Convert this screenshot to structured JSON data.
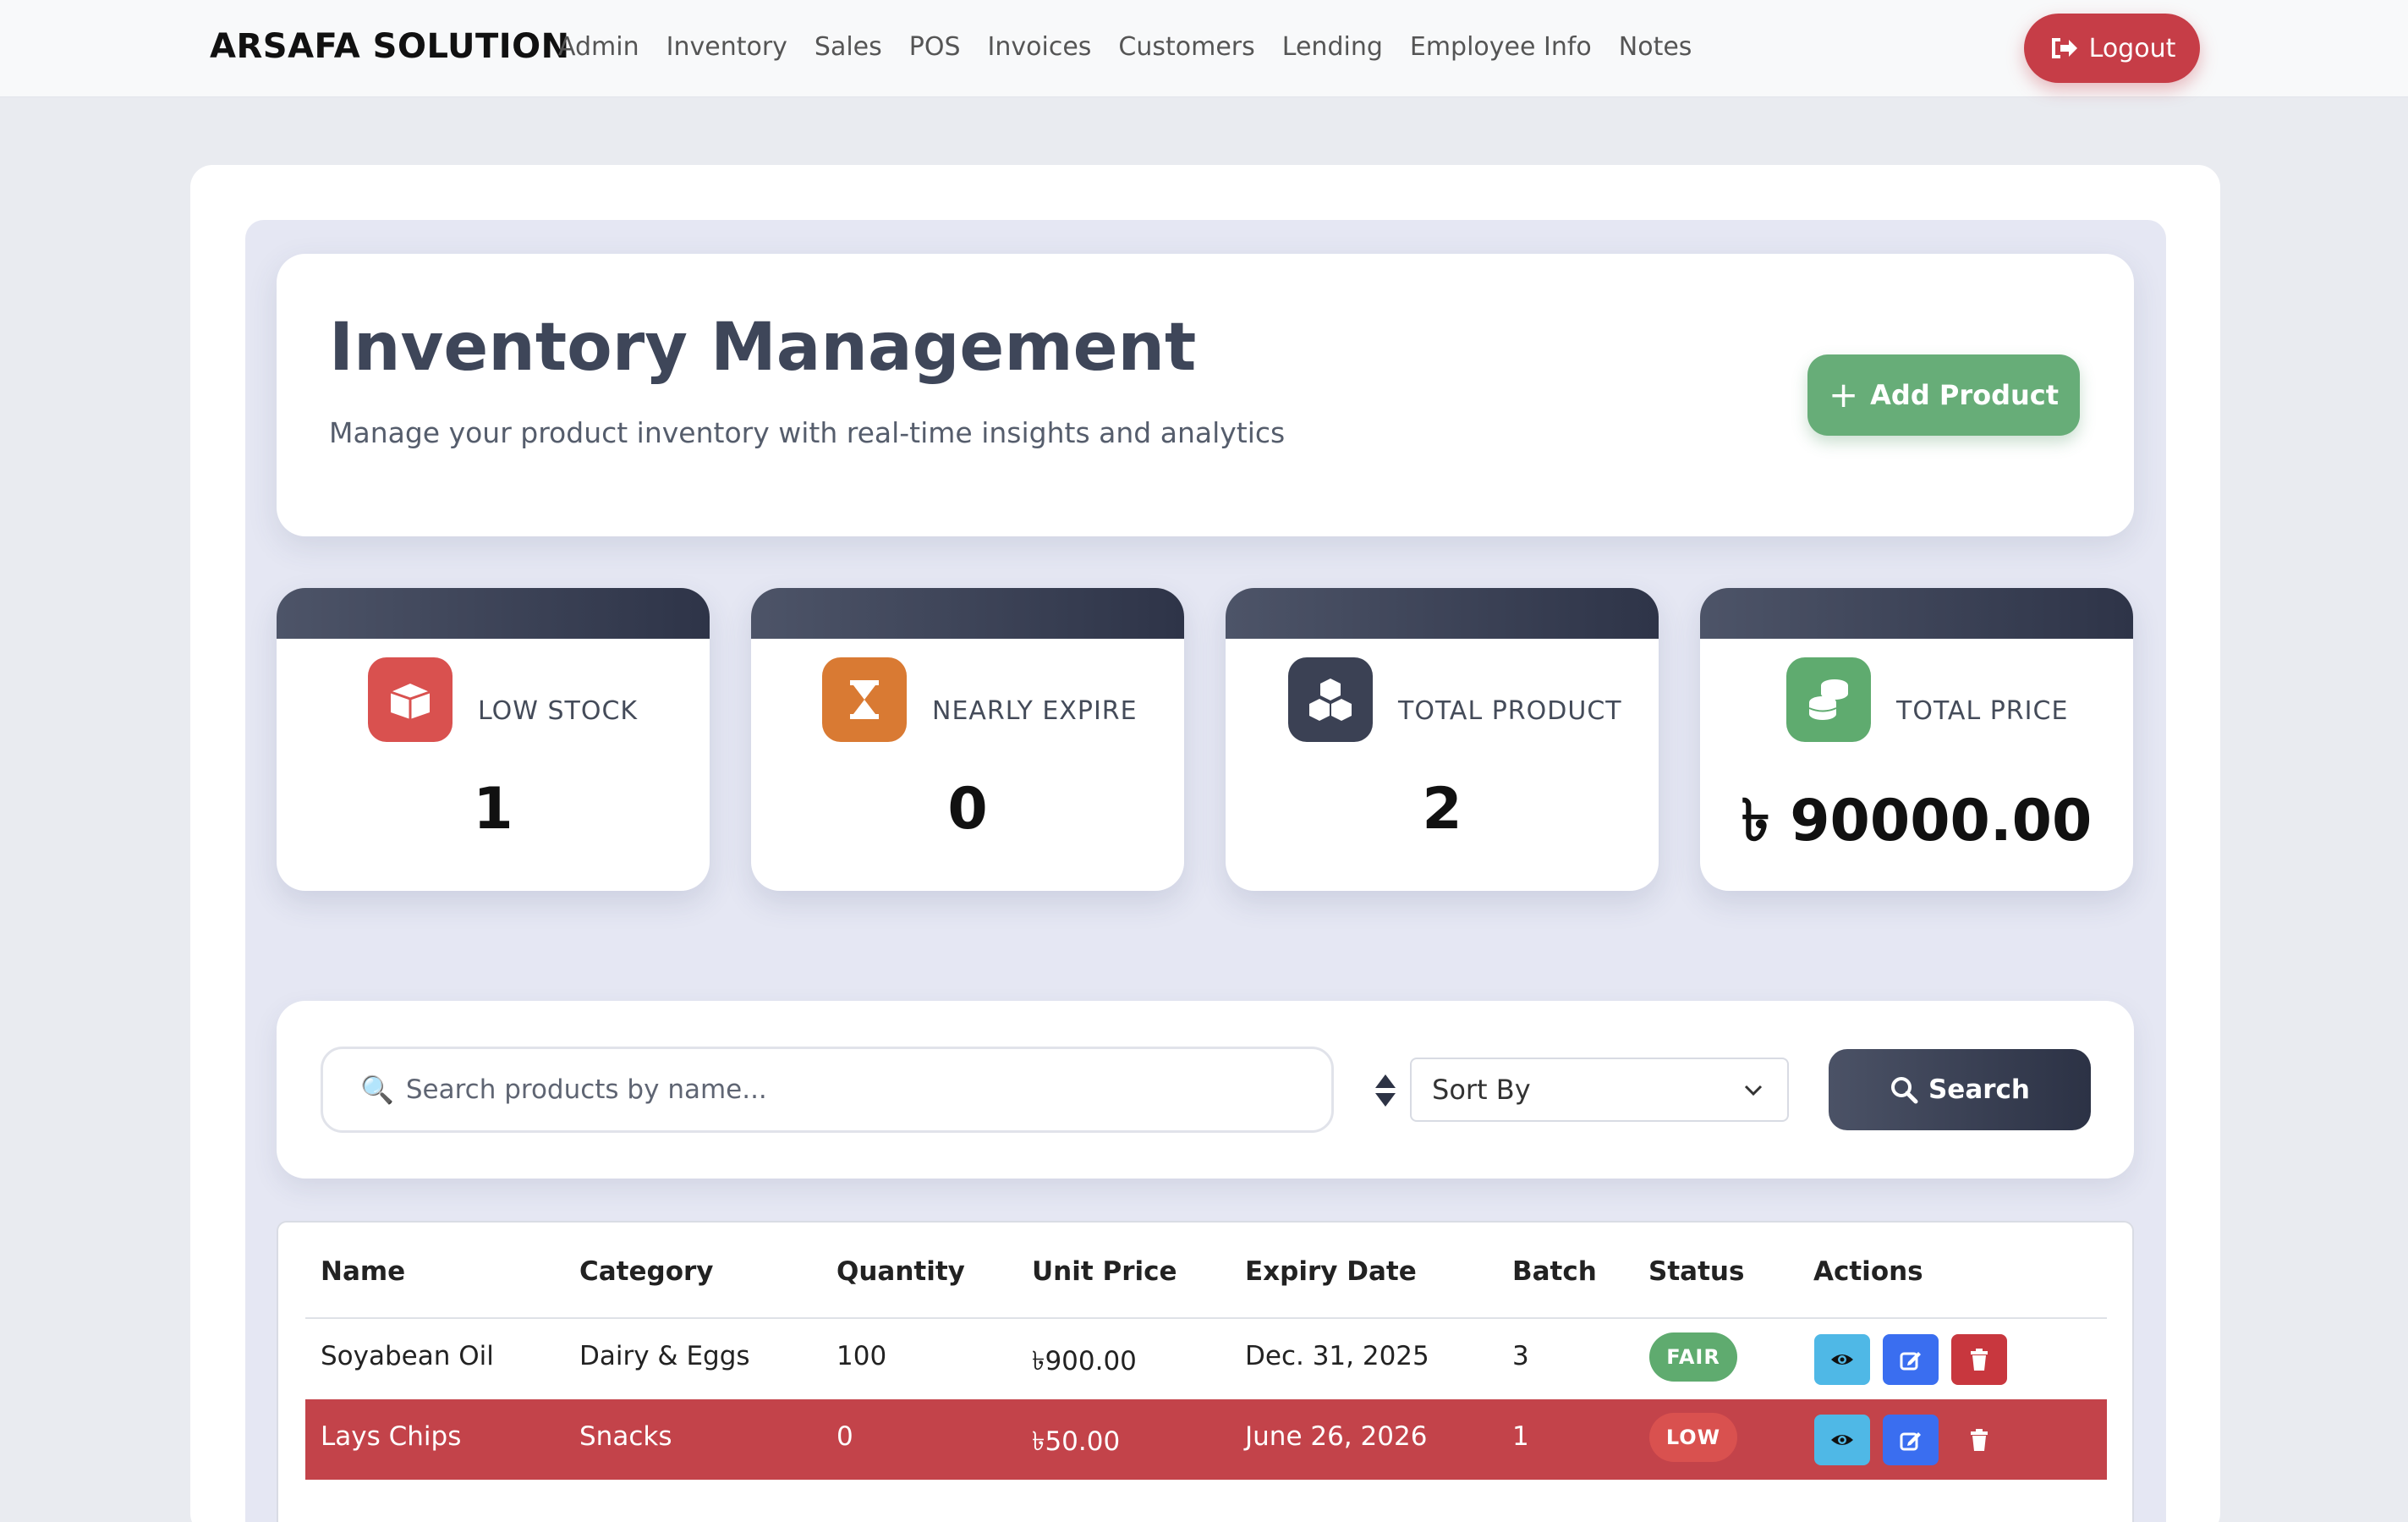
{
  "navbar": {
    "brand": "ARSAFA SOLUTION",
    "links": [
      "Admin",
      "Inventory",
      "Sales",
      "POS",
      "Invoices",
      "Customers",
      "Lending",
      "Employee Info",
      "Notes"
    ],
    "logout_label": "Logout"
  },
  "header": {
    "title": "Inventory Management",
    "subtitle": "Manage your product inventory with real-time insights and analytics",
    "add_button_label": "Add Product"
  },
  "stats": [
    {
      "label": "LOW STOCK",
      "value": "1",
      "icon": "box-open-icon",
      "color": "#d9514f"
    },
    {
      "label": "NEARLY EXPIRE",
      "value": "0",
      "icon": "hourglass-icon",
      "color": "#d97a33"
    },
    {
      "label": "TOTAL PRODUCT",
      "value": "2",
      "icon": "cubes-icon",
      "color": "#3b4154"
    },
    {
      "label": "TOTAL PRICE",
      "value": "৳ 90000.00",
      "icon": "coins-icon",
      "color": "#5fab6f"
    }
  ],
  "search": {
    "placeholder": "Search products by name...",
    "sort_value": "Sort By",
    "button_label": "Search"
  },
  "table": {
    "columns": [
      "Name",
      "Category",
      "Quantity",
      "Unit Price",
      "Expiry Date",
      "Batch",
      "Status",
      "Actions"
    ],
    "rows": [
      {
        "name": "Soyabean Oil",
        "category": "Dairy & Eggs",
        "quantity": "100",
        "unit_price": "৳900.00",
        "expiry": "Dec. 31, 2025",
        "batch": "3",
        "status": "FAIR"
      },
      {
        "name": "Lays Chips",
        "category": "Snacks",
        "quantity": "0",
        "unit_price": "৳50.00",
        "expiry": "June 26, 2026",
        "batch": "1",
        "status": "LOW"
      }
    ]
  },
  "colors": {
    "accent_green": "#67ad78",
    "danger": "#c3434a",
    "dark": "#2e3448"
  }
}
